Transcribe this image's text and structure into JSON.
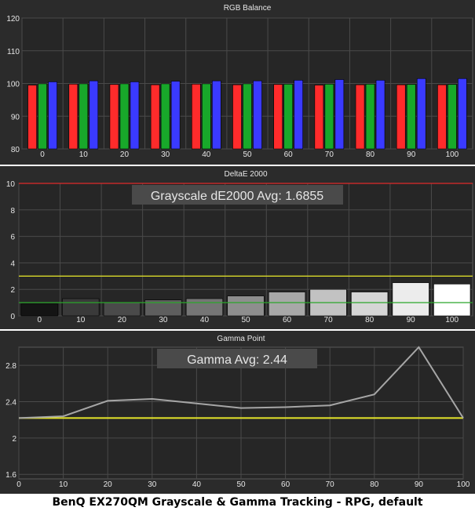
{
  "caption": "BenQ EX270QM Grayscale & Gamma Tracking - RPG, default",
  "colors": {
    "panel_bg": "#2b2b2b",
    "plot_bg": "#262626",
    "grid": "#4a4a4a",
    "text": "#e6e6e6",
    "red": "#ff2b2b",
    "green": "#18a82a",
    "blue": "#3a3aff",
    "threshold_high": "#d9d92a",
    "threshold_low": "#2aa62a",
    "limit_line": "#e02a2a",
    "gamma_line": "#a6a6a6",
    "gamma_target": "#e6e62a",
    "annotation_bg": "#4a4a4a"
  },
  "chart_data": [
    {
      "type": "bar",
      "title": "RGB Balance",
      "categories": [
        "0",
        "10",
        "20",
        "30",
        "40",
        "50",
        "60",
        "70",
        "80",
        "90",
        "100"
      ],
      "series": [
        {
          "name": "Red",
          "color": "#ff2b2b",
          "values": [
            99.5,
            99.8,
            99.7,
            99.6,
            99.8,
            99.6,
            99.7,
            99.5,
            99.6,
            99.6,
            99.6
          ]
        },
        {
          "name": "Green",
          "color": "#18a82a",
          "values": [
            99.9,
            99.9,
            99.9,
            99.9,
            99.9,
            99.9,
            99.8,
            99.8,
            99.8,
            99.7,
            99.7
          ]
        },
        {
          "name": "Blue",
          "color": "#3a3aff",
          "values": [
            100.5,
            100.8,
            100.5,
            100.7,
            100.8,
            100.8,
            101.0,
            101.2,
            101.0,
            101.5,
            101.5
          ]
        }
      ],
      "ylim": [
        80,
        120
      ],
      "yticks": [
        "80",
        "90",
        "100",
        "110",
        "120"
      ],
      "grid": true
    },
    {
      "type": "bar",
      "title": "DeltaE 2000",
      "annotation": "Grayscale dE2000 Avg: 1.6855",
      "categories": [
        "0",
        "10",
        "20",
        "30",
        "40",
        "50",
        "60",
        "70",
        "80",
        "90",
        "100"
      ],
      "values": [
        0.9,
        1.3,
        1.0,
        1.2,
        1.3,
        1.5,
        1.8,
        2.0,
        1.8,
        2.5,
        2.4
      ],
      "bar_colors": [
        "#141414",
        "#3a3a3a",
        "#4a4a4a",
        "#5e5e5e",
        "#757575",
        "#8e8e8e",
        "#a8a8a8",
        "#c2c2c2",
        "#d6d6d6",
        "#ececec",
        "#ffffff"
      ],
      "reference_lines": [
        {
          "value": 10,
          "color": "#e02a2a"
        },
        {
          "value": 3,
          "color": "#d9d92a"
        },
        {
          "value": 1,
          "color": "#2aa62a"
        }
      ],
      "ylim": [
        0,
        10
      ],
      "yticks": [
        "0",
        "2",
        "4",
        "6",
        "8",
        "10"
      ],
      "grid": true
    },
    {
      "type": "line",
      "title": "Gamma Point",
      "annotation": "Gamma Avg: 2.44",
      "x": [
        0,
        10,
        20,
        30,
        40,
        50,
        60,
        70,
        80,
        90,
        100
      ],
      "y": [
        2.22,
        2.24,
        2.41,
        2.43,
        2.38,
        2.33,
        2.34,
        2.36,
        2.48,
        3.0,
        2.22
      ],
      "target": 2.22,
      "xlim": [
        0,
        100
      ],
      "ylim": [
        1.55,
        3.0
      ],
      "yticks": [
        "1.6",
        "2",
        "2.4",
        "2.8"
      ],
      "xticks": [
        "0",
        "10",
        "20",
        "30",
        "40",
        "50",
        "60",
        "70",
        "80",
        "90",
        "100"
      ],
      "grid": true
    }
  ]
}
